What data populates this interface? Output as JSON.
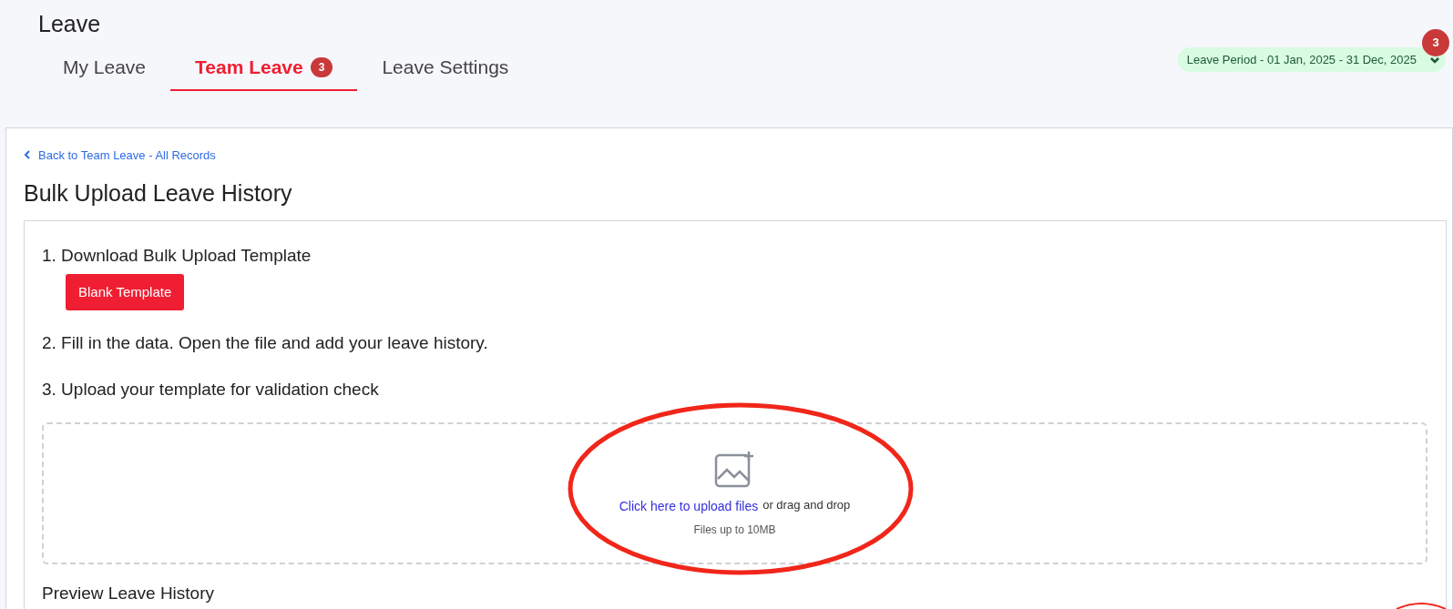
{
  "page_title": "Leave",
  "tabs": [
    {
      "label": "My Leave",
      "selected": false
    },
    {
      "label": "Team Leave",
      "selected": true,
      "badge": "3"
    },
    {
      "label": "Leave Settings",
      "selected": false
    }
  ],
  "period": {
    "label": "Leave Period - 01 Jan, 2025 - 31 Dec, 2025",
    "badge": "3"
  },
  "back_link": "Back to Team Leave - All Records",
  "heading": "Bulk Upload Leave History",
  "steps": [
    {
      "kind": "button",
      "text": "1. Download Bulk Upload Template",
      "button": "Blank Template"
    },
    {
      "kind": "text",
      "text": "2. Fill in the data. Open the file and add your leave history."
    },
    {
      "kind": "text",
      "text": "3. Upload your template for validation check"
    }
  ],
  "dropzone": {
    "link": "Click here to upload files",
    "rest": "or drag and drop",
    "hint": "Files up to 10MB"
  },
  "preview_heading": "Preview Leave History"
}
